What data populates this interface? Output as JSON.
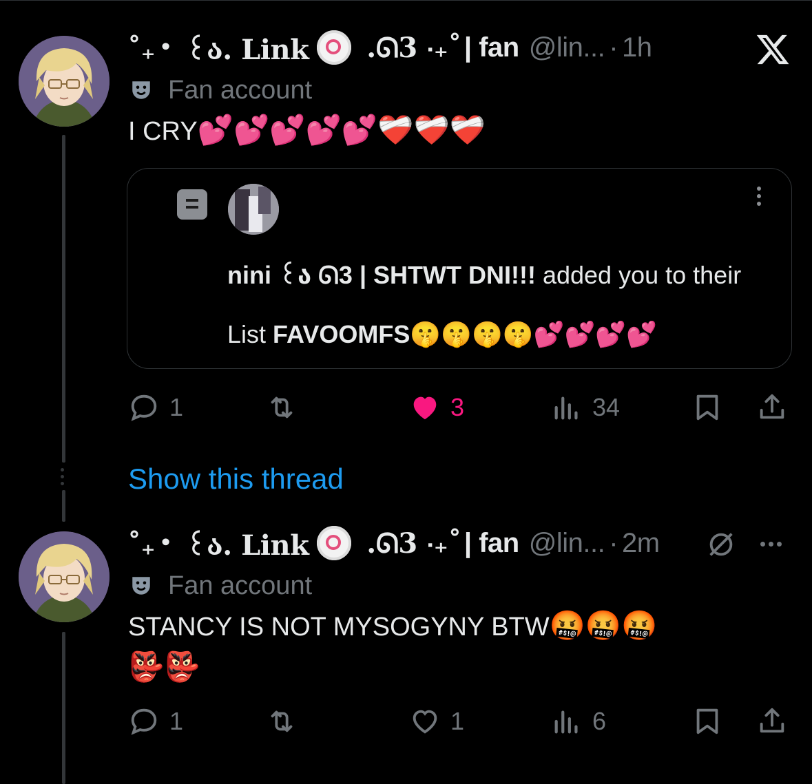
{
  "tweets": [
    {
      "display_name_prefix": "˚₊‧ ꒰ა. Link",
      "display_name_suffix": ".ᘏ3 ‧₊˚",
      "fan_tag": "| fan",
      "handle": "@lin...",
      "separator": "·",
      "time": "1h",
      "label": "Fan account",
      "text": "I CRY",
      "emojis": "💕💕💕💕💕❤️‍🩹❤️‍🩹❤️‍🩹",
      "quote": {
        "name": "nini ꒰ა ᘏ3 | SHTWT DNI!!!",
        "action": " added you to their",
        "list_prefix": "List ",
        "list_name": "FAVOOMFS",
        "list_emojis": "🤫🤫🤫🤫💕💕💕💕"
      },
      "replies": "1",
      "retweets": "",
      "likes": "3",
      "views": "34",
      "liked": true
    },
    {
      "display_name_prefix": "˚₊‧ ꒰ა. Link",
      "display_name_suffix": ".ᘏ3 ‧₊˚",
      "fan_tag": "| fan",
      "handle": "@lin...",
      "separator": "·",
      "time": "2m",
      "label": "Fan account",
      "text": "STANCY IS NOT MYSOGYNY BTW",
      "emojis": "🤬🤬🤬",
      "emojis_line2": "👺👺",
      "replies": "1",
      "retweets": "",
      "likes": "1",
      "views": "6",
      "liked": false
    }
  ],
  "show_thread_label": "Show this thread",
  "colors": {
    "background": "#000000",
    "text": "#e7e9ea",
    "muted": "#71767b",
    "link": "#1d9bf0",
    "like": "#f91880",
    "border": "#2f3336"
  }
}
